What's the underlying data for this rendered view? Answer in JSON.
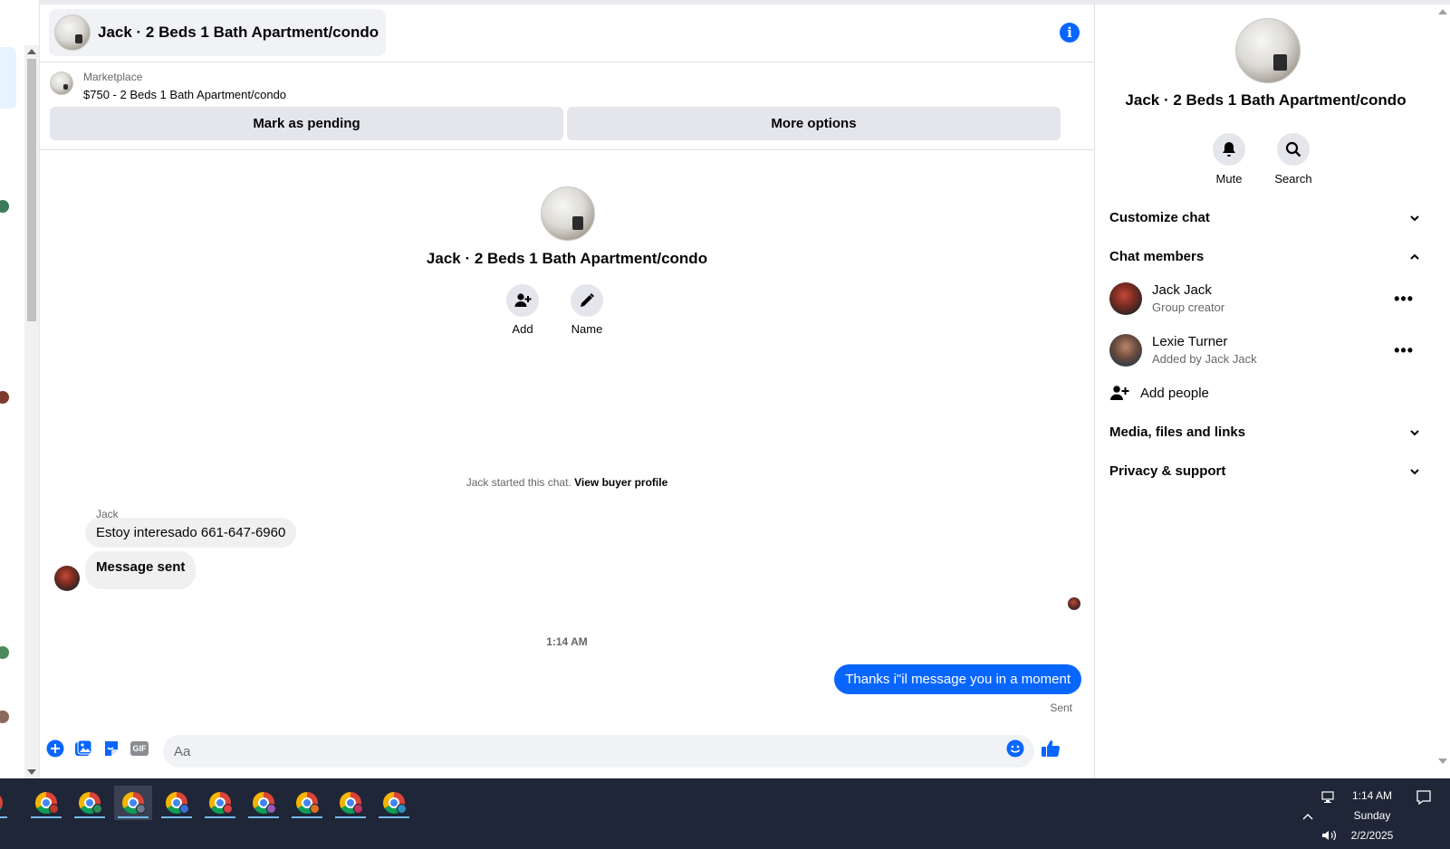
{
  "header": {
    "title": "Jack · 2 Beds 1 Bath Apartment/condo",
    "info_icon": "info-icon"
  },
  "marketplace": {
    "label": "Marketplace",
    "listing": "$750 - 2 Beds 1 Bath Apartment/condo",
    "mark_pending_label": "Mark as pending",
    "more_options_label": "More options"
  },
  "chat": {
    "title": "Jack · 2 Beds 1 Bath Apartment/condo",
    "add_label": "Add",
    "name_label": "Name",
    "started_text": "Jack started this chat.",
    "view_buyer_label": "View buyer profile",
    "sender_name": "Jack",
    "messages_in": [
      "Estoy interesado 661-647-6960",
      "Message sent"
    ],
    "timestamp": "1:14 AM",
    "message_out": "Thanks i\"il message you in a moment",
    "sent_label": "Sent"
  },
  "composer": {
    "placeholder": "Aa",
    "icons": [
      "plus-icon",
      "photo-icon",
      "sticker-icon",
      "gif-icon",
      "emoji-icon",
      "thumbs-up-icon"
    ],
    "gif_text": "GIF"
  },
  "right_panel": {
    "title": "Jack · 2 Beds 1 Bath Apartment/condo",
    "mute_label": "Mute",
    "search_label": "Search",
    "customize_chat": "Customize chat",
    "chat_members": "Chat members",
    "members": [
      {
        "name": "Jack Jack",
        "role": "Group creator"
      },
      {
        "name": "Lexie Turner",
        "role": "Added by Jack Jack"
      }
    ],
    "add_people": "Add people",
    "media_files_links": "Media, files and links",
    "privacy_support": "Privacy & support"
  },
  "taskbar": {
    "time": "1:14 AM",
    "day": "Sunday",
    "date": "2/2/2025",
    "app_count": 9,
    "active_app_index": 2
  },
  "colors": {
    "accent": "#0866ff",
    "taskbar": "#1f2637",
    "bubble_in": "#f0f0f0"
  }
}
